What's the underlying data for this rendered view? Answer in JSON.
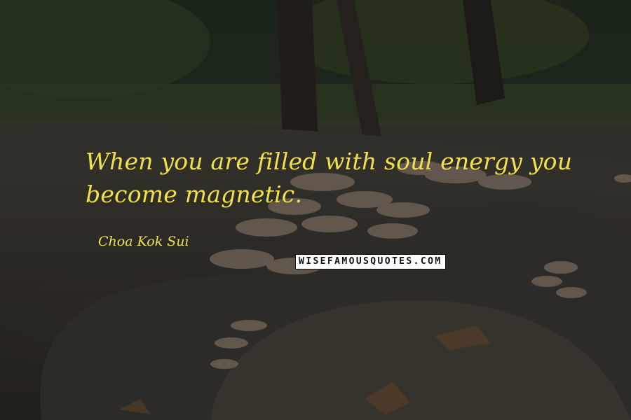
{
  "quote": {
    "text": "When you are filled with soul energy you become magnetic.",
    "author": "Choa Kok Sui",
    "color": "#f2e04a"
  },
  "watermark": {
    "text": "WISEFAMOUSQUOTES.COM"
  },
  "background": {
    "description_color_dark": "#2b2a25"
  }
}
